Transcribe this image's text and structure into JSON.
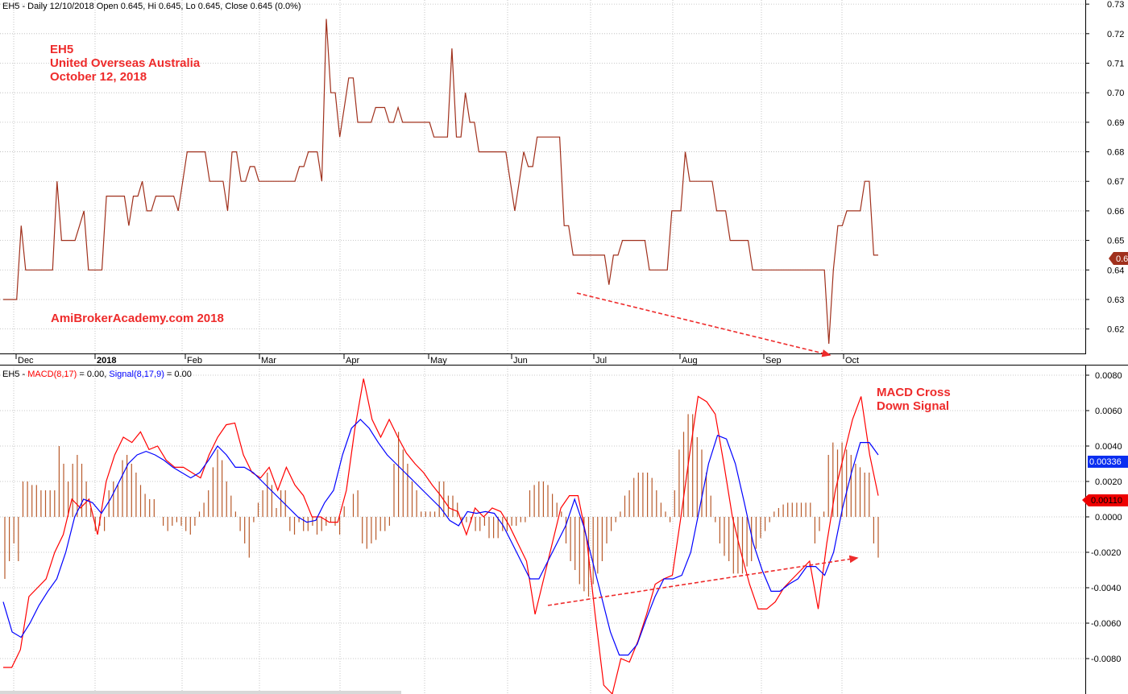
{
  "colors": {
    "price": "#a0301c",
    "macd": "#ff0000",
    "signal": "#0000ff",
    "hist": "#b85a2a",
    "annotation": "#ee2b2b",
    "trend": "#ee2b2b"
  },
  "price_pane": {
    "header": "EH5 - Daily 12/10/2018 Open 0.645, Hi 0.645, Lo 0.645, Close 0.645 (0.0%)",
    "last_value_tag": "0.645"
  },
  "macd_pane": {
    "header_ticker": "EH5 - ",
    "header_macd": "MACD(8,17)",
    "header_macd_value": " = 0.00, ",
    "header_signal": "Signal(8,17,9)",
    "header_signal_value": " = 0.00",
    "macd_tag": "0.00336",
    "signal_tag": "0.00110"
  },
  "annotations": {
    "ticker": "EH5",
    "company": "United Overseas Australia",
    "date": "October 12, 2018",
    "watermark": "AmiBrokerAcademy.com  2018",
    "macd_note_line1": "MACD Cross",
    "macd_note_line2": "Down Signal"
  },
  "chart_data": [
    {
      "type": "line",
      "series": [
        {
          "values": [
            0.63,
            0.63,
            0.63,
            0.63,
            0.655,
            0.64,
            0.64,
            0.64,
            0.64,
            0.64,
            0.64,
            0.64,
            0.67,
            0.65,
            0.65,
            0.65,
            0.65,
            0.655,
            0.66,
            0.64,
            0.64,
            0.64,
            0.64,
            0.665,
            0.665,
            0.665,
            0.665,
            0.665,
            0.655,
            0.665,
            0.665,
            0.67,
            0.66,
            0.66,
            0.665,
            0.665,
            0.665,
            0.665,
            0.665,
            0.66,
            0.67,
            0.68,
            0.68,
            0.68,
            0.68,
            0.68,
            0.67,
            0.67,
            0.67,
            0.67,
            0.66,
            0.68,
            0.68,
            0.67,
            0.67,
            0.675,
            0.675,
            0.67,
            0.67,
            0.67,
            0.67,
            0.67,
            0.67,
            0.67,
            0.67,
            0.67,
            0.675,
            0.675,
            0.68,
            0.68,
            0.68,
            0.67,
            0.725,
            0.7,
            0.7,
            0.685,
            0.695,
            0.705,
            0.705,
            0.69,
            0.69,
            0.69,
            0.69,
            0.695,
            0.695,
            0.695,
            0.69,
            0.69,
            0.695,
            0.69,
            0.69,
            0.69,
            0.69,
            0.69,
            0.69,
            0.69,
            0.685,
            0.685,
            0.685,
            0.685,
            0.715,
            0.685,
            0.685,
            0.7,
            0.69,
            0.69,
            0.68,
            0.68,
            0.68,
            0.68,
            0.68,
            0.68,
            0.68,
            0.67,
            0.66,
            0.67,
            0.68,
            0.675,
            0.675,
            0.685,
            0.685,
            0.685,
            0.685,
            0.685,
            0.685,
            0.655,
            0.655,
            0.645,
            0.645,
            0.645,
            0.645,
            0.645,
            0.645,
            0.645,
            0.645,
            0.635,
            0.645,
            0.645,
            0.65,
            0.65,
            0.65,
            0.65,
            0.65,
            0.65,
            0.64,
            0.64,
            0.64,
            0.64,
            0.64,
            0.66,
            0.66,
            0.66,
            0.68,
            0.67,
            0.67,
            0.67,
            0.67,
            0.67,
            0.67,
            0.66,
            0.66,
            0.66,
            0.65,
            0.65,
            0.65,
            0.65,
            0.65,
            0.64,
            0.64,
            0.64,
            0.64,
            0.64,
            0.64,
            0.64,
            0.64,
            0.64,
            0.64,
            0.64,
            0.64,
            0.64,
            0.64,
            0.64,
            0.64,
            0.64,
            0.615,
            0.64,
            0.655,
            0.655,
            0.66,
            0.66,
            0.66,
            0.66,
            0.67,
            0.67,
            0.645,
            0.645
          ]
        }
      ],
      "categories": [
        "Dec",
        "2018",
        "Feb",
        "Mar",
        "Apr",
        "May",
        "Jun",
        "Jul",
        "Aug",
        "Sep",
        "Oct"
      ],
      "y_ticks": [
        "0.62",
        "0.63",
        "0.64",
        "0.65",
        "0.66",
        "0.67",
        "0.68",
        "0.69",
        "0.70",
        "0.71",
        "0.72",
        "0.73"
      ],
      "ylim": [
        0.612,
        0.7314
      ],
      "grid": true
    },
    {
      "type": "line",
      "series": [
        {
          "name": "MACD(8,17)",
          "values": [
            -0.0085,
            -0.0085,
            -0.0075,
            -0.0045,
            -0.004,
            -0.0035,
            -0.002,
            -0.001,
            0.001,
            0.0005,
            0.001,
            -0.001,
            0.002,
            0.0035,
            0.0045,
            0.0042,
            0.0048,
            0.0038,
            0.004,
            0.0032,
            0.0028,
            0.0028,
            0.0025,
            0.0022,
            0.0035,
            0.0045,
            0.0052,
            0.0053,
            0.0035,
            0.0025,
            0.0022,
            0.0028,
            0.0015,
            0.0028,
            0.0018,
            0.0012,
            0.0,
            0.0,
            -0.0003,
            -0.0003,
            0.0015,
            0.005,
            0.0078,
            0.0055,
            0.0045,
            0.0055,
            0.0045,
            0.0036,
            0.003,
            0.0025,
            0.0018,
            0.0012,
            0.0005,
            0.0003,
            -0.001,
            0.0005,
            0.0,
            0.0005,
            0.0003,
            -0.0005,
            -0.0015,
            -0.0025,
            -0.0055,
            -0.0035,
            -0.0015,
            0.0005,
            0.0012,
            0.0012,
            -0.0012,
            -0.0055,
            -0.0095,
            -0.01,
            -0.008,
            -0.0082,
            -0.007,
            -0.0055,
            -0.0038,
            -0.0035,
            -0.0033,
            0.0,
            0.0035,
            0.0068,
            0.0065,
            0.0058,
            0.003,
            0.0,
            -0.002,
            -0.0038,
            -0.0052,
            -0.0052,
            -0.0048,
            -0.004,
            -0.0035,
            -0.003,
            -0.0025,
            -0.0052,
            -0.0015,
            0.0015,
            0.0035,
            0.0055,
            0.0068,
            0.0035,
            0.0012
          ]
        },
        {
          "name": "Signal(8,17,9)",
          "values": [
            -0.0048,
            -0.0065,
            -0.0068,
            -0.006,
            -0.005,
            -0.0042,
            -0.0035,
            -0.002,
            0.0,
            0.001,
            0.0008,
            0.0002,
            0.001,
            0.002,
            0.003,
            0.0035,
            0.0037,
            0.0035,
            0.0032,
            0.0028,
            0.0025,
            0.0022,
            0.0025,
            0.0032,
            0.004,
            0.0035,
            0.0028,
            0.0028,
            0.0025,
            0.002,
            0.0015,
            0.001,
            0.0005,
            0.0,
            -0.0003,
            -0.0002,
            0.0008,
            0.0015,
            0.0035,
            0.005,
            0.0055,
            0.005,
            0.0042,
            0.0035,
            0.003,
            0.0025,
            0.002,
            0.0015,
            0.001,
            0.0005,
            -0.0002,
            -0.0005,
            0.0003,
            0.0002,
            0.0003,
            0.0002,
            -0.0005,
            -0.0015,
            -0.0025,
            -0.0035,
            -0.0035,
            -0.0025,
            -0.0015,
            -0.0005,
            0.001,
            -0.0005,
            -0.0025,
            -0.0045,
            -0.0065,
            -0.0078,
            -0.0078,
            -0.0072,
            -0.0058,
            -0.0045,
            -0.0035,
            -0.0035,
            -0.0033,
            -0.002,
            0.0005,
            0.003,
            0.0046,
            0.0044,
            0.003,
            0.0008,
            -0.0015,
            -0.003,
            -0.0042,
            -0.0042,
            -0.0038,
            -0.0035,
            -0.0028,
            -0.0028,
            -0.0033,
            -0.002,
            0.0005,
            0.0025,
            0.0042,
            0.0042,
            0.0035
          ]
        }
      ],
      "categories": [
        "Dec",
        "2018",
        "Feb",
        "Mar",
        "Apr",
        "May",
        "Jun",
        "Jul",
        "Aug",
        "Sep",
        "Oct"
      ],
      "y_ticks": [
        "-0.0080",
        "-0.0060",
        "-0.0040",
        "-0.0020",
        "0.0000",
        "0.0020",
        "0.0040",
        "0.0060",
        "0.0080"
      ],
      "ylim": [
        -0.01,
        0.0085
      ],
      "grid": true
    },
    {
      "type": "bar",
      "series": [
        {
          "values": [
            -0.0035,
            -0.0025,
            -0.0015,
            -0.0025,
            0.002,
            0.002,
            0.0018,
            0.0018,
            0.0015,
            0.0015,
            0.0015,
            0.0015,
            0.004,
            0.003,
            0.002,
            0.003,
            0.0035,
            0.003,
            0.002,
            0.0005,
            -0.0008,
            -0.0005,
            -0.0008,
            0.0015,
            0.002,
            0.0018,
            0.0032,
            0.0035,
            0.003,
            0.0025,
            0.0018,
            0.0013,
            0.001,
            0.001,
            0.0,
            -0.0005,
            -0.0008,
            -0.0005,
            -0.0003,
            -0.0005,
            -0.0008,
            -0.001,
            -0.0005,
            0.0003,
            0.0008,
            0.0015,
            0.0028,
            0.0038,
            0.0032,
            0.002,
            0.0012,
            0.0003,
            -0.0008,
            -0.0015,
            -0.0023,
            -0.0003,
            0.0008,
            0.0015,
            0.0025,
            0.0018,
            0.0005,
            0.0015,
            0.0015,
            -0.0008,
            -0.001,
            -0.0003,
            -0.0008,
            -0.0008,
            -0.0005,
            -0.001,
            -0.0008,
            -0.0005,
            -0.0003,
            -0.0005,
            -0.001,
            0.0006,
            0.0,
            0.0013,
            0.0015,
            -0.0015,
            -0.0018,
            -0.0015,
            -0.0013,
            -0.0008,
            -0.0008,
            -0.0005,
            0.003,
            0.0048,
            0.0038,
            0.003,
            0.002,
            0.0015,
            0.0003,
            0.0003,
            0.0003,
            0.0003,
            0.002,
            0.002,
            0.0012,
            0.0012,
            0.0008,
            -0.0003,
            -0.0003,
            -0.0003,
            -0.0008,
            -0.0008,
            -0.0005,
            -0.0012,
            -0.0012,
            -0.0012,
            -0.0008,
            -0.0008,
            -0.0005,
            -0.0005,
            -0.0003,
            -0.0003,
            0.0015,
            0.0018,
            0.002,
            0.002,
            0.0018,
            0.0013,
            0.0008,
            0.0003,
            -0.0015,
            -0.0025,
            -0.003,
            -0.0038,
            -0.0042,
            -0.0045,
            -0.0038,
            -0.0032,
            -0.0025,
            -0.0015,
            -0.0008,
            -0.0003,
            0.0003,
            0.0012,
            0.0015,
            0.0022,
            0.0025,
            0.0025,
            0.0025,
            0.0022,
            0.0015,
            0.0008,
            0.0003,
            -0.0003,
            0.0015,
            0.0038,
            0.0048,
            0.0058,
            0.0058,
            0.0045,
            0.0038,
            0.0025,
            0.0012,
            -0.0003,
            -0.0015,
            -0.0022,
            -0.0025,
            -0.0032,
            -0.0032,
            -0.0032,
            -0.0028,
            -0.0025,
            -0.0018,
            -0.0012,
            -0.0008,
            -0.0003,
            0.0003,
            0.0005,
            0.0007,
            0.0008,
            0.0008,
            0.0008,
            0.0008,
            0.0008,
            0.0008,
            -0.0015,
            -0.0008,
            0.0003,
            0.0035,
            0.0042,
            0.0038,
            0.0042,
            0.0038,
            0.0035,
            0.003,
            0.0028,
            0.0025,
            0.0025,
            -0.0015,
            -0.0023
          ]
        }
      ],
      "ylim": [
        -0.01,
        0.0085
      ]
    }
  ]
}
